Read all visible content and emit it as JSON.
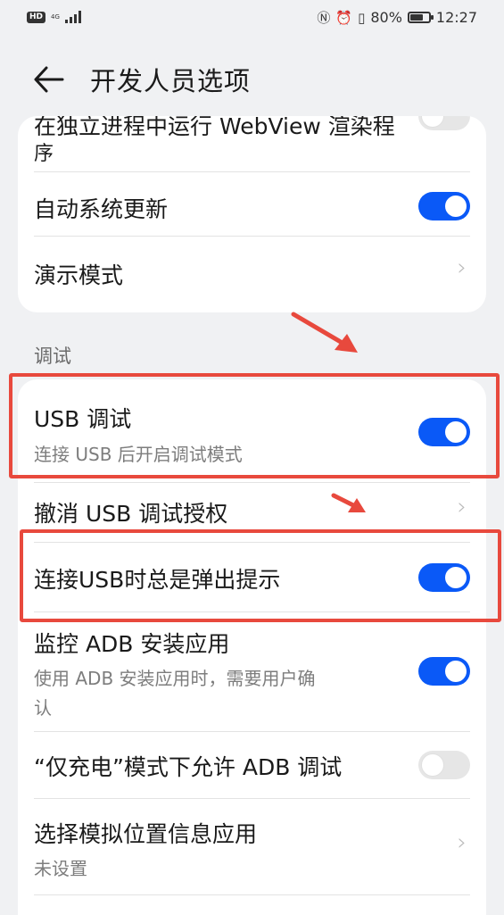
{
  "status_bar": {
    "hd_badge": "HD",
    "network": "4G",
    "battery_percent_text": "80%",
    "battery_level": 0.8,
    "time": "12:27"
  },
  "header": {
    "title": "开发人员选项"
  },
  "card_top": {
    "items": [
      {
        "label_line1": "在独立进程中运行 WebView 渲染程",
        "label_line2": "序",
        "toggle": "off"
      },
      {
        "label": "自动系统更新",
        "toggle": "on"
      },
      {
        "label": "演示模式",
        "control": "chevron"
      }
    ]
  },
  "section_debug": {
    "title": "调试"
  },
  "card_debug": {
    "items": [
      {
        "label": "USB 调试",
        "sublabel": "连接 USB 后开启调试模式",
        "toggle": "on"
      },
      {
        "label": "撤消 USB 调试授权",
        "control": "chevron"
      },
      {
        "label": "连接USB时总是弹出提示",
        "toggle": "on"
      },
      {
        "label": "监控 ADB 安装应用",
        "sublabel_line1": "使用 ADB 安装应用时，需要用户确",
        "sublabel_line2": "认",
        "toggle": "on"
      },
      {
        "label": "“仅充电”模式下允许 ADB 调试",
        "toggle": "off"
      },
      {
        "label": "选择模拟位置信息应用",
        "sublabel": "未设置",
        "control": "chevron"
      }
    ]
  },
  "colors": {
    "accent": "#0a59f7",
    "annotation_red": "#e8493d",
    "background": "#f0f1f3"
  }
}
